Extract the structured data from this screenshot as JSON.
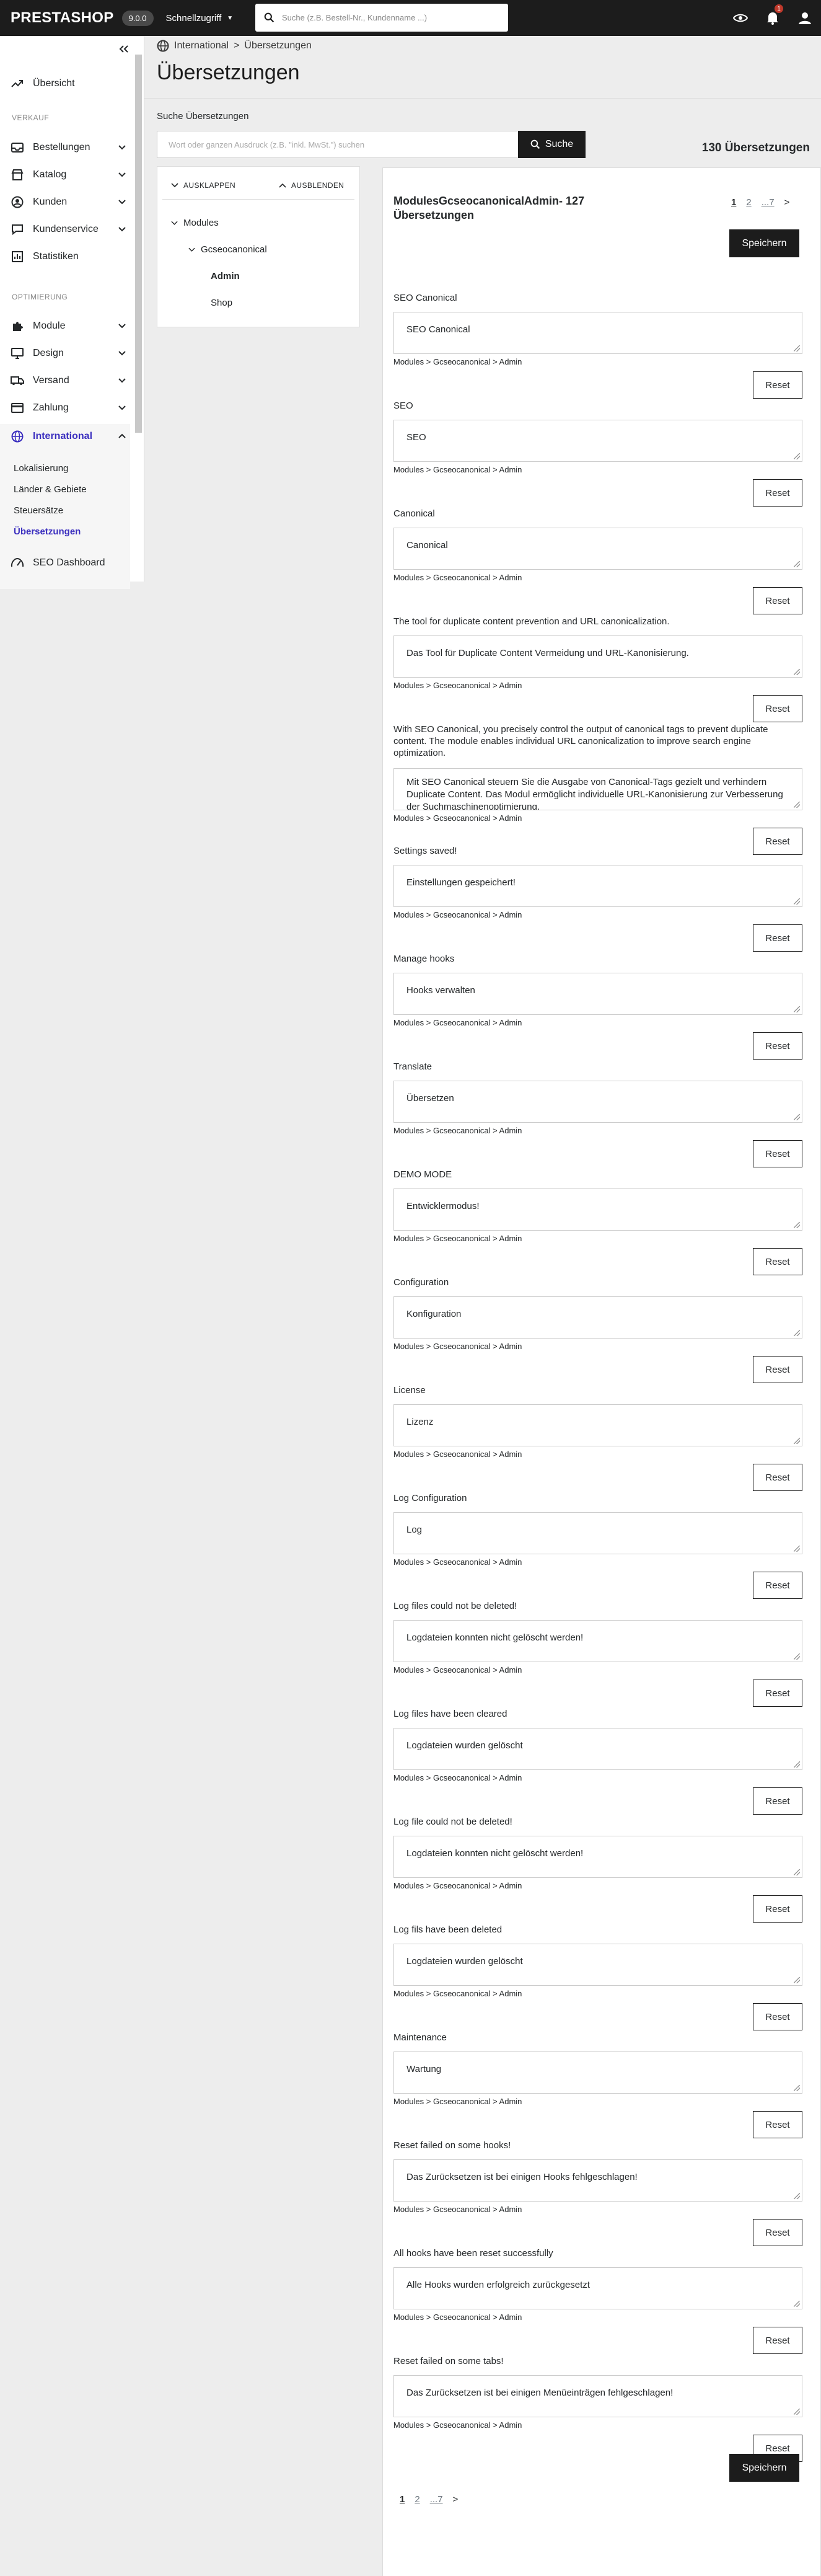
{
  "topbar": {
    "logo": "PRESTASHOP",
    "version": "9.0.0",
    "quick_access": "Schnellzugriff",
    "search_placeholder": "Suche (z.B. Bestell-Nr., Kundenname ...)",
    "notifications_count": "1"
  },
  "sidebar": {
    "overview": "Übersicht",
    "sec_sales": "VERKAUF",
    "orders": "Bestellungen",
    "catalog": "Katalog",
    "customers": "Kunden",
    "customer_service": "Kundenservice",
    "stats": "Statistiken",
    "sec_optimize": "OPTIMIERUNG",
    "modules": "Module",
    "design": "Design",
    "shipping": "Versand",
    "payment": "Zahlung",
    "international": "International",
    "sub": [
      "Lokalisierung",
      "Länder & Gebiete",
      "Steuersätze",
      "Übersetzungen"
    ],
    "seo_dashboard": "SEO Dashboard"
  },
  "breadcrumb": {
    "parent": "International",
    "current": "Übersetzungen"
  },
  "page_title": "Übersetzungen",
  "search": {
    "label": "Suche Übersetzungen",
    "placeholder": "Wort oder ganzen Ausdruck (z.B. \"inkl. MwSt.\") suchen",
    "button": "Suche"
  },
  "count_label": "130 Übersetzungen",
  "tree": {
    "expand": "AUSKLAPPEN",
    "collapse": "AUSBLENDEN",
    "root": "Modules",
    "module": "Gcseocanonical",
    "leaf_admin": "Admin",
    "leaf_shop": "Shop"
  },
  "panel": {
    "title": "ModulesGcseocanonicalAdmin- 127 Übersetzungen",
    "pages": {
      "p1": "1",
      "p2": "2",
      "p_last": "...7",
      "next": ">"
    },
    "save": "Speichern",
    "reset": "Reset",
    "path": "Modules > Gcseocanonical > Admin",
    "items": [
      {
        "source": "SEO Canonical",
        "translation": "SEO Canonical"
      },
      {
        "source": "SEO",
        "translation": "SEO"
      },
      {
        "source": "Canonical",
        "translation": "Canonical"
      },
      {
        "source": "The tool for duplicate content prevention and URL canonicalization.",
        "translation": "Das Tool für Duplicate Content Vermeidung und URL-Kanonisierung."
      },
      {
        "source": "With SEO Canonical, you precisely control the output of canonical tags to prevent duplicate content. The module enables individual URL canonicalization to improve search engine optimization.",
        "translation": "Mit SEO Canonical steuern Sie die Ausgabe von Canonical-Tags gezielt und verhindern Duplicate Content. Das Modul ermöglicht individuelle URL-Kanonisierung zur Verbesserung der Suchmaschinenoptimierung."
      },
      {
        "source": "Settings saved!",
        "translation": "Einstellungen gespeichert!"
      },
      {
        "source": "Manage hooks",
        "translation": "Hooks verwalten"
      },
      {
        "source": "Translate",
        "translation": "Übersetzen"
      },
      {
        "source": "DEMO MODE",
        "translation": "Entwicklermodus!"
      },
      {
        "source": "Configuration",
        "translation": "Konfiguration"
      },
      {
        "source": "License",
        "translation": "Lizenz"
      },
      {
        "source": "Log Configuration",
        "translation": "Log"
      },
      {
        "source": "Log files could not be deleted!",
        "translation": "Logdateien konnten nicht gelöscht werden!"
      },
      {
        "source": "Log files have been cleared",
        "translation": "Logdateien wurden gelöscht"
      },
      {
        "source": "Log file could not be deleted!",
        "translation": "Logdateien konnten nicht gelöscht werden!"
      },
      {
        "source": "Log fils have been deleted",
        "translation": "Logdateien wurden gelöscht"
      },
      {
        "source": "Maintenance",
        "translation": "Wartung"
      },
      {
        "source": "Reset failed on some hooks!",
        "translation": "Das Zurücksetzen ist bei einigen Hooks fehlgeschlagen!"
      },
      {
        "source": "All hooks have been reset successfully",
        "translation": "Alle Hooks wurden erfolgreich zurückgesetzt"
      },
      {
        "source": "Reset failed on some tabs!",
        "translation": "Das Zurücksetzen ist bei einigen Menüeinträgen fehlgeschlagen!"
      }
    ]
  }
}
